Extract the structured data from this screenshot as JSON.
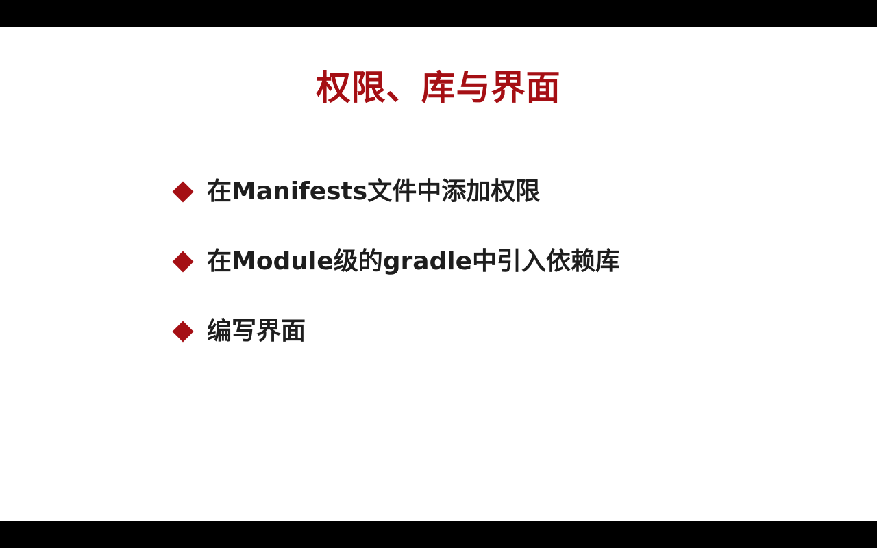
{
  "slide": {
    "title": "权限、库与界面",
    "bullets": [
      {
        "text": "在Manifests文件中添加权限",
        "icon": "diamond-bullet-icon"
      },
      {
        "text": "在Module级的gradle中引入依赖库",
        "icon": "diamond-bullet-icon"
      },
      {
        "text": "编写界面",
        "icon": "diamond-bullet-icon"
      }
    ]
  },
  "colors": {
    "accent": "#a50f14",
    "text": "#1e1e1e",
    "background": "#ffffff",
    "letterbox": "#000000"
  }
}
